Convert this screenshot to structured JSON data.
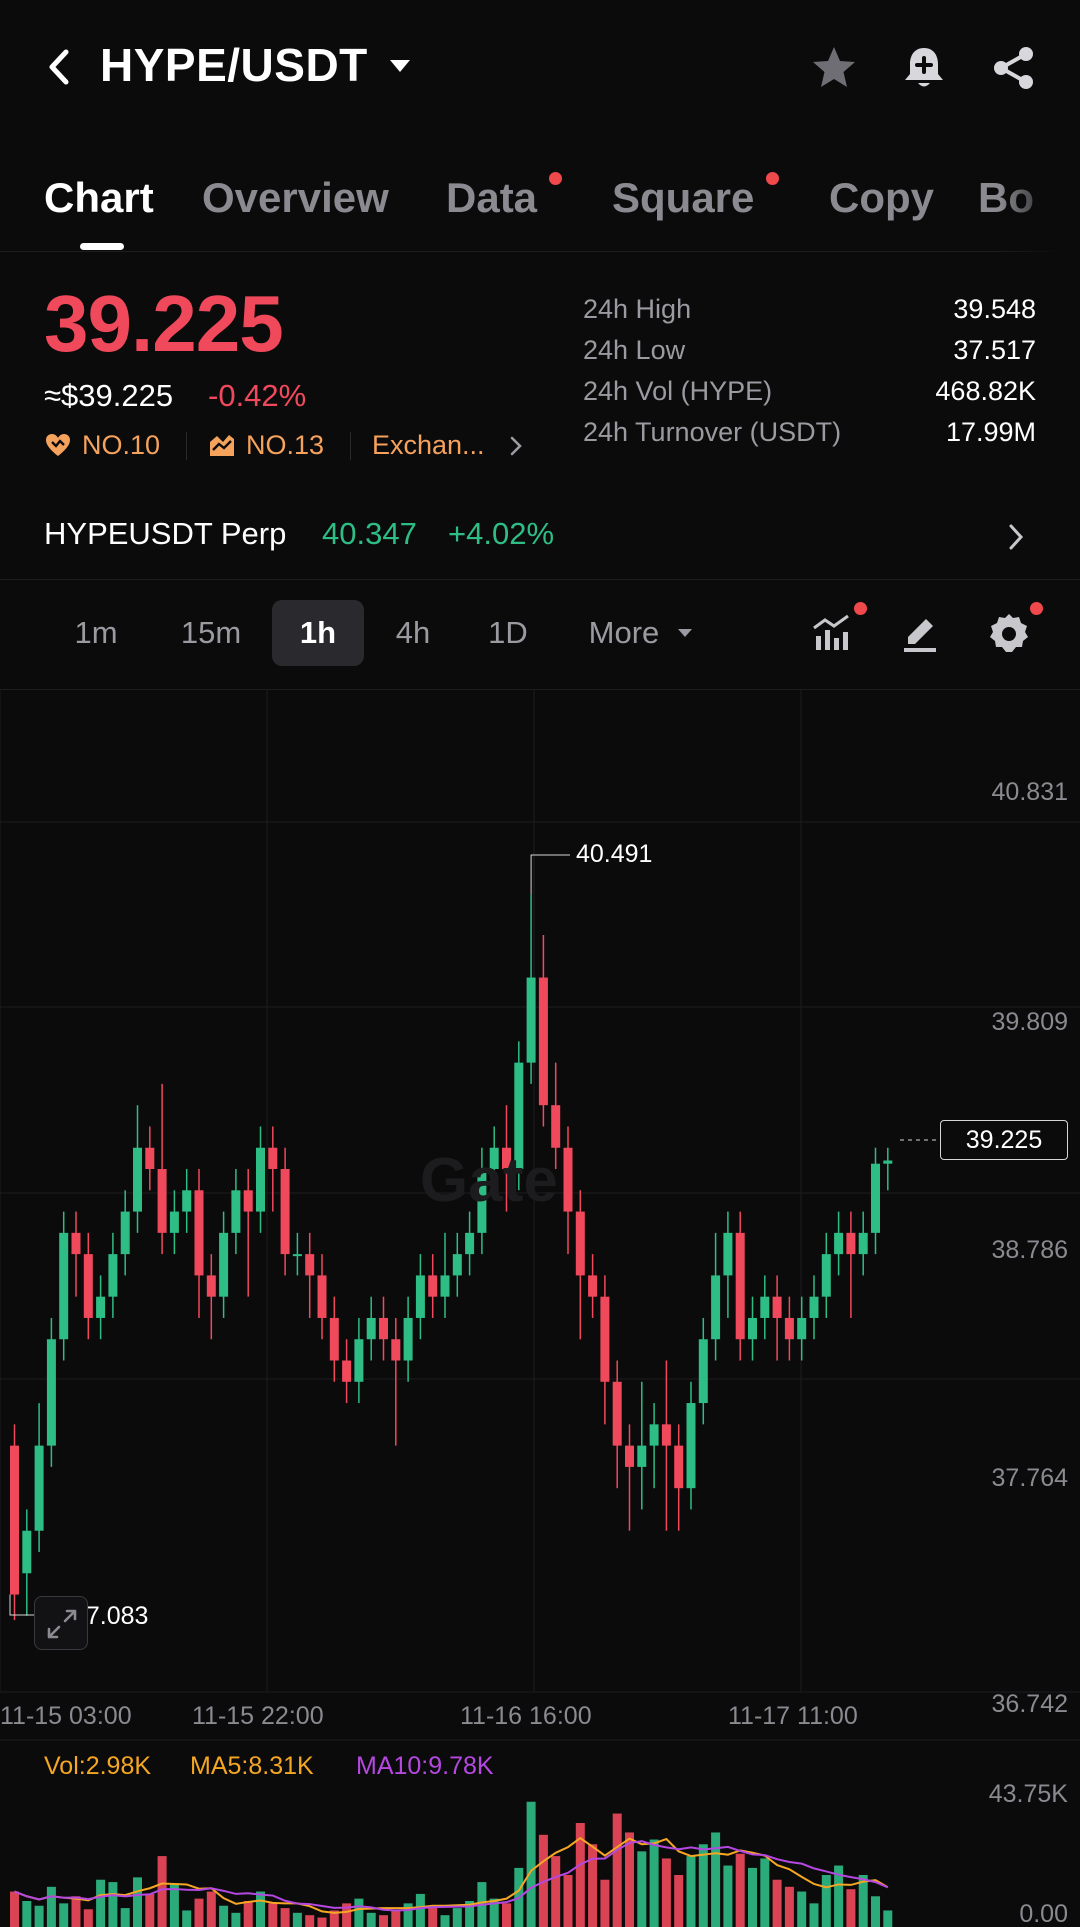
{
  "header": {
    "pair": "HYPE/USDT"
  },
  "tabs": [
    {
      "label": "Chart"
    },
    {
      "label": "Overview"
    },
    {
      "label": "Data"
    },
    {
      "label": "Square"
    },
    {
      "label": "Copy"
    },
    {
      "label": "Bo"
    }
  ],
  "price": {
    "last": "39.225",
    "usd": "≈$39.225",
    "change": "-0.42%",
    "rank1": "NO.10",
    "rank2": "NO.13",
    "exchange": "Exchan..."
  },
  "stats": [
    {
      "label": "24h High",
      "value": "39.548"
    },
    {
      "label": "24h Low",
      "value": "37.517"
    },
    {
      "label": "24h Vol (HYPE)",
      "value": "468.82K"
    },
    {
      "label": "24h Turnover (USDT)",
      "value": "17.99M"
    }
  ],
  "perp": {
    "name": "HYPEUSDT Perp",
    "price": "40.347",
    "change": "+4.02%"
  },
  "intervals": [
    {
      "label": "1m"
    },
    {
      "label": "15m"
    },
    {
      "label": "1h"
    },
    {
      "label": "4h"
    },
    {
      "label": "1D"
    },
    {
      "label": "More"
    }
  ],
  "chart": {
    "y_axis": [
      "40.831",
      "39.809",
      "38.786",
      "37.764",
      "36.742"
    ],
    "x_axis": [
      "11-15 03:00",
      "11-15 22:00",
      "11-16 16:00",
      "11-17 11:00"
    ],
    "current_price": "39.225",
    "high_label": "40.491",
    "low_label": "37.083",
    "watermark": "Gate",
    "vol_legend": {
      "vol": "Vol:2.98K",
      "ma5": "MA5:8.31K",
      "ma10": "MA10:9.78K"
    },
    "vol_axis": [
      "43.75K",
      "0.00"
    ]
  },
  "colors": {
    "up": "#2ebd85",
    "down": "#f0495c",
    "accent": "#f5a25d",
    "ma5": "#f5a623",
    "ma10": "#b548e0"
  }
}
